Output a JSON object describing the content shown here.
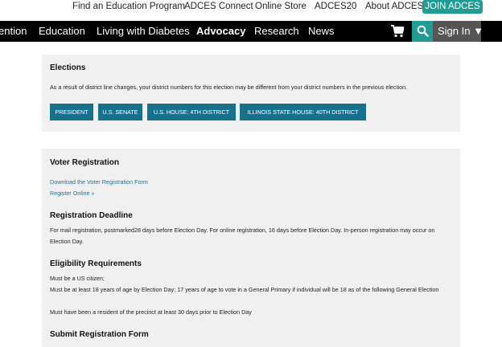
{
  "top_links": {
    "find_program": "Find an Education Program",
    "adces_connect": "ADCES Connect",
    "online_store": "Online Store",
    "adces20": "ADCES20",
    "about": "About ADCES",
    "join": "JOIN ADCES"
  },
  "main_nav": {
    "items": [
      "ention",
      "Education",
      "Living with Diabetes",
      "Advocacy",
      "Research",
      "News"
    ],
    "active": "Advocacy",
    "sign_in": "Sign In ▼"
  },
  "icons": {
    "cart": "shopping-cart-icon",
    "search": "search-icon"
  },
  "colors": {
    "accent_teal": "#1f9c94",
    "district_button": "#17718c",
    "link": "#2a6e8e",
    "nav_bg": "#000000"
  },
  "elections": {
    "title": "Elections",
    "note": "As a result of district line changes, your district numbers for this election may be different from your district numbers in the previous election.",
    "buttons": [
      "PRESIDENT",
      "U.S. SENATE",
      "U.S. HOUSE: 4TH DISTRICT",
      "ILLINOIS STATE HOUSE: 40TH DISTRICT"
    ]
  },
  "voter_registration": {
    "title": "Voter Registration",
    "download_link": "Download the Voter Registration Form",
    "register_link": "Register Online »",
    "deadline_title": "Registration Deadline",
    "deadline_text": "For mail registration, postmarked28 days before Election Day. For online registration, 16 days before Election Day. In-person registration may occur on Election Day.",
    "eligibility_title": "Eligibility Requirements",
    "eligibility": [
      "Must be a US citizen;",
      "Must be at least 18 years of age by Election Day; 17 years of age to vote in a General Primary if individual will be 18 as of the following General Election",
      "Must have been a resident of the precinct at least 30 days prior to Election Day"
    ],
    "submit_title": "Submit Registration Form"
  }
}
